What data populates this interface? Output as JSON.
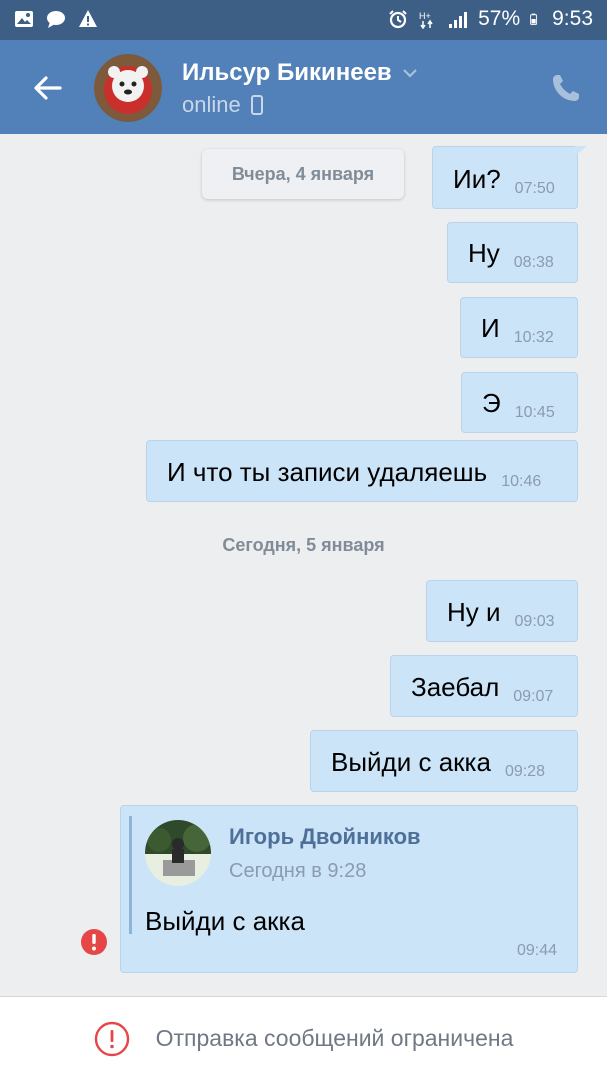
{
  "status_bar": {
    "battery_percent": "57%",
    "time": "9:53",
    "left_icons": [
      "gallery-icon",
      "chat-icon",
      "warning-icon"
    ],
    "right_icons": [
      "alarm-icon",
      "network-icon",
      "signal-icon",
      "battery-icon"
    ]
  },
  "header": {
    "contact_name": "Ильсур Бикинеев",
    "status": "online",
    "colors": {
      "background": "#5181b8",
      "status_bar": "#3e5f85"
    }
  },
  "dates": {
    "yesterday": "Вчера, 4 января",
    "today": "Сегодня, 5 января"
  },
  "messages": [
    {
      "text": "Ии?",
      "time": "07:50"
    },
    {
      "text": "Ну",
      "time": "08:38"
    },
    {
      "text": "И",
      "time": "10:32"
    },
    {
      "text": "Э",
      "time": "10:45"
    },
    {
      "text": "И что ты записи удаляешь",
      "time": "10:46"
    },
    {
      "text": "Ну и",
      "time": "09:03"
    },
    {
      "text": "Заебал",
      "time": "09:07"
    },
    {
      "text": "Выйди с акка",
      "time": "09:28"
    }
  ],
  "forwarded": {
    "author": "Игорь Двойников",
    "date": "Сегодня в 9:28",
    "text": "Выйди с акка",
    "time": "09:44"
  },
  "bottom_bar": {
    "text": "Отправка сообщений ограничена"
  },
  "colors": {
    "bubble": "#cce4f7",
    "error": "#e64646",
    "chat_background": "#edeef0"
  }
}
